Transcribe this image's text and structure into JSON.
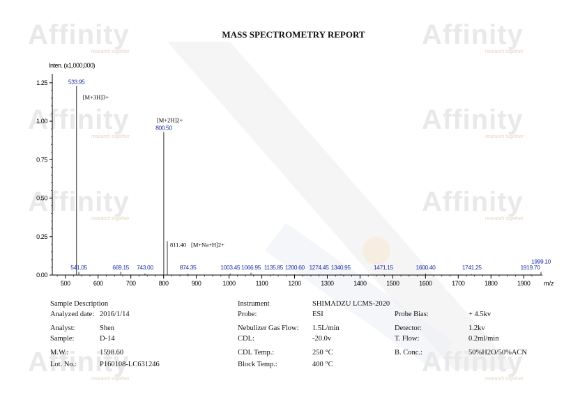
{
  "report_title": "MASS SPECTROMETRY REPORT",
  "watermark_text": "Affinity",
  "watermark_tagline": "research together",
  "chart_data": {
    "type": "bar",
    "y_axis_title": "Inten. (x1,000,000)",
    "x_axis_title": "m/z",
    "xlim": [
      460,
      1940
    ],
    "ylim": [
      0,
      1.29
    ],
    "x_ticks": [
      "500",
      "600",
      "700",
      "800",
      "900",
      "1000",
      "1100",
      "1200",
      "1300",
      "1400",
      "1500",
      "1600",
      "1700",
      "1800",
      "1900"
    ],
    "y_ticks": [
      "0.00",
      "0.25",
      "0.50",
      "0.75",
      "1.00",
      "1.25"
    ],
    "peaks": [
      {
        "mz": 533.95,
        "label": "533.95",
        "intensity": 1.23
      },
      {
        "mz": 541.05,
        "label": "541.05",
        "intensity": 0.02
      },
      {
        "mz": 669.15,
        "label": "669.15",
        "intensity": 0.02
      },
      {
        "mz": 743.0,
        "label": "743.00",
        "intensity": 0.01
      },
      {
        "mz": 800.5,
        "label": "800.50",
        "intensity": 0.93
      },
      {
        "mz": 811.4,
        "label": "811.40",
        "intensity": 0.22
      },
      {
        "mz": 874.35,
        "label": "874.35",
        "intensity": 0.01
      },
      {
        "mz": 1003.45,
        "label": "1003.45",
        "intensity": 0.01
      },
      {
        "mz": 1066.95,
        "label": "1066.95",
        "intensity": 0.015
      },
      {
        "mz": 1135.85,
        "label": "1135.85",
        "intensity": 0.005
      },
      {
        "mz": 1200.6,
        "label": "1200.60",
        "intensity": 0.005
      },
      {
        "mz": 1274.45,
        "label": "1274.45",
        "intensity": 0.005
      },
      {
        "mz": 1340.95,
        "label": "1340.95",
        "intensity": 0.005
      },
      {
        "mz": 1471.15,
        "label": "1471.15",
        "intensity": 0.005
      },
      {
        "mz": 1600.4,
        "label": "1600.40",
        "intensity": 0.01
      },
      {
        "mz": 1741.25,
        "label": "1741.25",
        "intensity": 0.005
      },
      {
        "mz": 1919.7,
        "label": "1919.70",
        "intensity": 0.005
      },
      {
        "mz": 1999.1,
        "label": "1999.10",
        "intensity": 0.02
      }
    ],
    "annotations": [
      {
        "mz": 533.95,
        "text": "[M+3H]3+"
      },
      {
        "mz": 800.5,
        "text": "[M+2H]2+"
      },
      {
        "mz": 811.4,
        "text": "[M+Na+H]2+"
      }
    ],
    "colors": {
      "axis": "#000000",
      "peak": "#333333",
      "peak_label": "#1a2ea0",
      "annotation": "#000000"
    }
  },
  "info": {
    "sample_description": "Sample Description",
    "analyzed_date_label": "Analyzed date:",
    "analyzed_date": "2016/1/14",
    "analyst_label": "Analyst:",
    "analyst": "Shen",
    "sample_label": "Sample:",
    "sample": "D-14",
    "mw_label": "M.W.:",
    "mw": "1598.60",
    "lot_label": "Lot. No.:",
    "lot": "P160108-LC631246",
    "instrument_label": "Instrument",
    "instrument": "SHIMADZU LCMS-2020",
    "probe_label": "Probe:",
    "probe": "ESI",
    "probe_bias_label": "Probe Bias:",
    "probe_bias": "+ 4.5kv",
    "nebulizer_label": "Nebulizer Gas Flow:",
    "nebulizer": "1.5L/min",
    "detector_label": "Detector:",
    "detector": "1.2kv",
    "cdl_label": "CDL:",
    "cdl": "-20.0v",
    "tflow_label": "T. Flow:",
    "tflow": "0.2ml/min",
    "cdl_temp_label": "CDL Temp.:",
    "cdl_temp": "250 °C",
    "bconc_label": "B. Conc.:",
    "bconc": "50%H2O/50%ACN",
    "block_temp_label": "Block Temp.:",
    "block_temp": "400 °C"
  }
}
